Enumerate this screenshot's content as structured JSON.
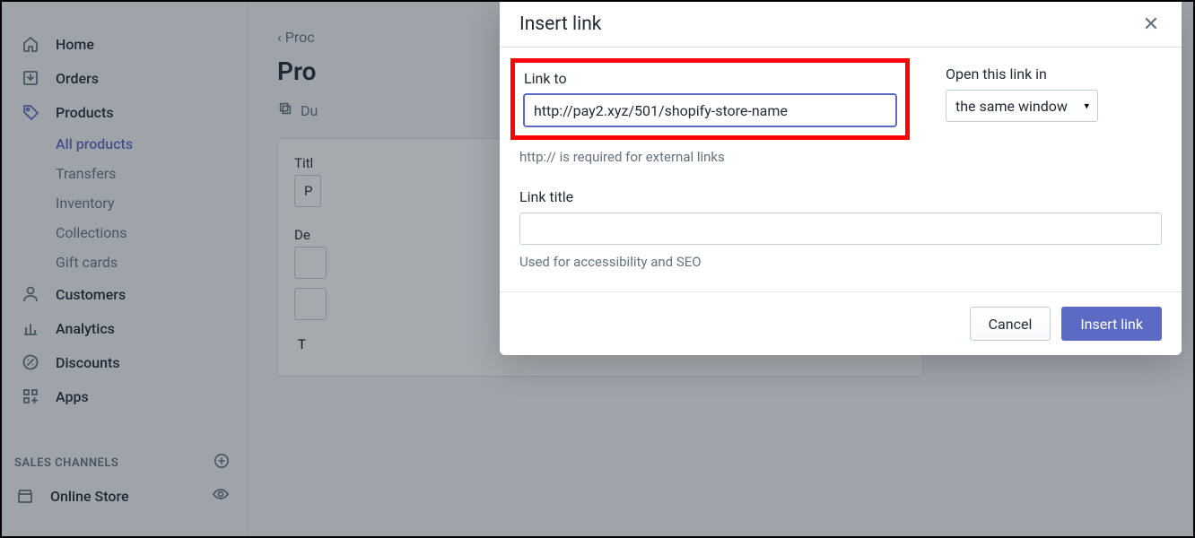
{
  "sidebar": {
    "items": [
      {
        "label": "Home"
      },
      {
        "label": "Orders"
      },
      {
        "label": "Products"
      },
      {
        "label": "Customers"
      },
      {
        "label": "Analytics"
      },
      {
        "label": "Discounts"
      },
      {
        "label": "Apps"
      }
    ],
    "products_sub": [
      {
        "label": "All products"
      },
      {
        "label": "Transfers"
      },
      {
        "label": "Inventory"
      },
      {
        "label": "Collections"
      },
      {
        "label": "Gift cards"
      }
    ],
    "section_label": "SALES CHANNELS",
    "channels": [
      {
        "label": "Online Store"
      }
    ]
  },
  "page": {
    "breadcrumb_back": "Proc",
    "title": "Pro",
    "duplicate": "Du",
    "title_label": "Titl",
    "title_value": "P",
    "description_label": "De",
    "body_text": "T"
  },
  "modal": {
    "title": "Insert link",
    "link_to_label": "Link to",
    "link_to_value": "http://pay2.xyz/501/shopify-store-name",
    "link_to_help": "http:// is required for external links",
    "open_in_label": "Open this link in",
    "open_in_value": "the same window",
    "link_title_label": "Link title",
    "link_title_value": "",
    "link_title_help": "Used for accessibility and SEO",
    "cancel": "Cancel",
    "submit": "Insert link"
  }
}
